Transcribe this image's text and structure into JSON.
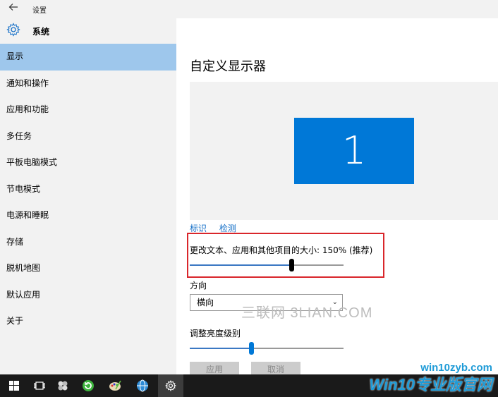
{
  "window": {
    "title": "设置",
    "back_icon": "arrow-left-icon"
  },
  "sidebar": {
    "header": {
      "icon": "gear-icon",
      "title": "系统"
    },
    "items": [
      {
        "label": "显示",
        "active": true
      },
      {
        "label": "通知和操作"
      },
      {
        "label": "应用和功能"
      },
      {
        "label": "多任务"
      },
      {
        "label": "平板电脑模式"
      },
      {
        "label": "节电模式"
      },
      {
        "label": "电源和睡眠"
      },
      {
        "label": "存储"
      },
      {
        "label": "脱机地图"
      },
      {
        "label": "默认应用"
      },
      {
        "label": "关于"
      }
    ]
  },
  "main": {
    "heading": "自定义显示器",
    "monitor_number": "1",
    "identify_link": "标识",
    "detect_link": "检测",
    "scale_label": "更改文本、应用和其他项目的大小: 150% (推荐)",
    "scale_slider_level": 0.68,
    "orientation_label": "方向",
    "orientation_value": "横向",
    "brightness_label": "调整亮度级别",
    "brightness_slider_level": 0.4,
    "apply_button": "应用",
    "cancel_button": "取消"
  },
  "watermark": {
    "text": "三联网 3LIAN.COM"
  },
  "taskbar": {
    "icons": [
      "windows-start-icon",
      "task-view-icon",
      "pinwheel-app-icon",
      "green-refresh-browser-icon",
      "paint-palette-icon",
      "globe-shield-icon",
      "settings-gear-icon"
    ]
  },
  "branding": {
    "url": "win10zyb.com",
    "name": "Win10专业版官网"
  },
  "colors": {
    "accent": "#0078d7",
    "selected_bg": "#9ec7ec",
    "link": "#1670c8",
    "highlight_box": "#d9262b"
  }
}
